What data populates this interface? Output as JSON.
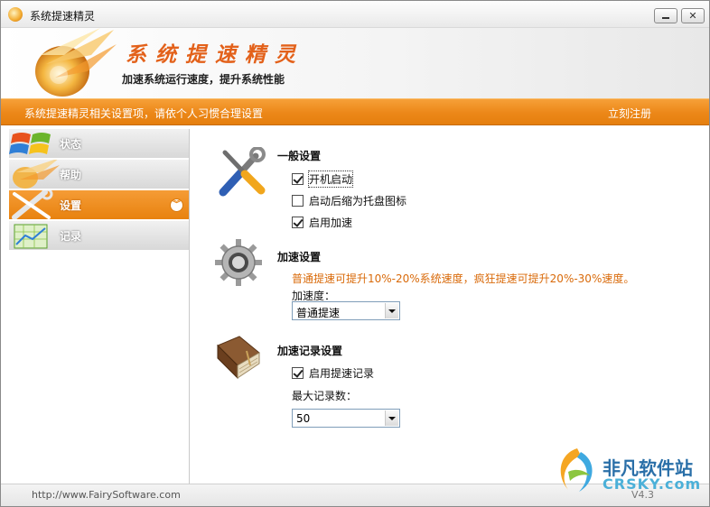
{
  "window": {
    "title": "系统提速精灵",
    "minimize_label": "",
    "close_label": "✕"
  },
  "banner": {
    "title": "系统提速精灵",
    "subtitle": "加速系统运行速度，提升系统性能"
  },
  "strip": {
    "description": "系统提速精灵相关设置项，请依个人习惯合理设置",
    "register_link": "立刻注册"
  },
  "sidebar": {
    "items": [
      {
        "label": "状态",
        "icon": "windows-logo-icon",
        "active": false
      },
      {
        "label": "帮助",
        "icon": "help-logo-icon",
        "active": false
      },
      {
        "label": "设置",
        "icon": "tools-icon",
        "active": true
      },
      {
        "label": "记录",
        "icon": "chart-record-icon",
        "active": false
      }
    ],
    "chevron": "︾"
  },
  "general": {
    "title": "一般设置",
    "icon": "wrench-screwdriver-icon",
    "options": [
      {
        "label": "开机启动",
        "checked": true
      },
      {
        "label": "启动后缩为托盘图标",
        "checked": false
      },
      {
        "label": "启用加速",
        "checked": true
      }
    ]
  },
  "accel": {
    "title": "加速设置",
    "icon": "gear-icon",
    "note": "普通提速可提升10%-20%系统速度，疯狂提速可提升20%-30%速度。",
    "speed_label": "加速度：",
    "speed_value": "普通提速"
  },
  "record": {
    "title": "加速记录设置",
    "icon": "book-icon",
    "enable_label": "启用提速记录",
    "enable_checked": true,
    "max_label": "最大记录数：",
    "max_value": "50"
  },
  "footer": {
    "url": "http://www.FairySoftware.com",
    "version": "V4.3"
  },
  "watermark": {
    "cn": "非凡软件站",
    "en": "CRSKY.com"
  },
  "colors": {
    "accent": "#ec8718",
    "title_orange": "#e3611a",
    "note_orange": "#d96a0a"
  }
}
